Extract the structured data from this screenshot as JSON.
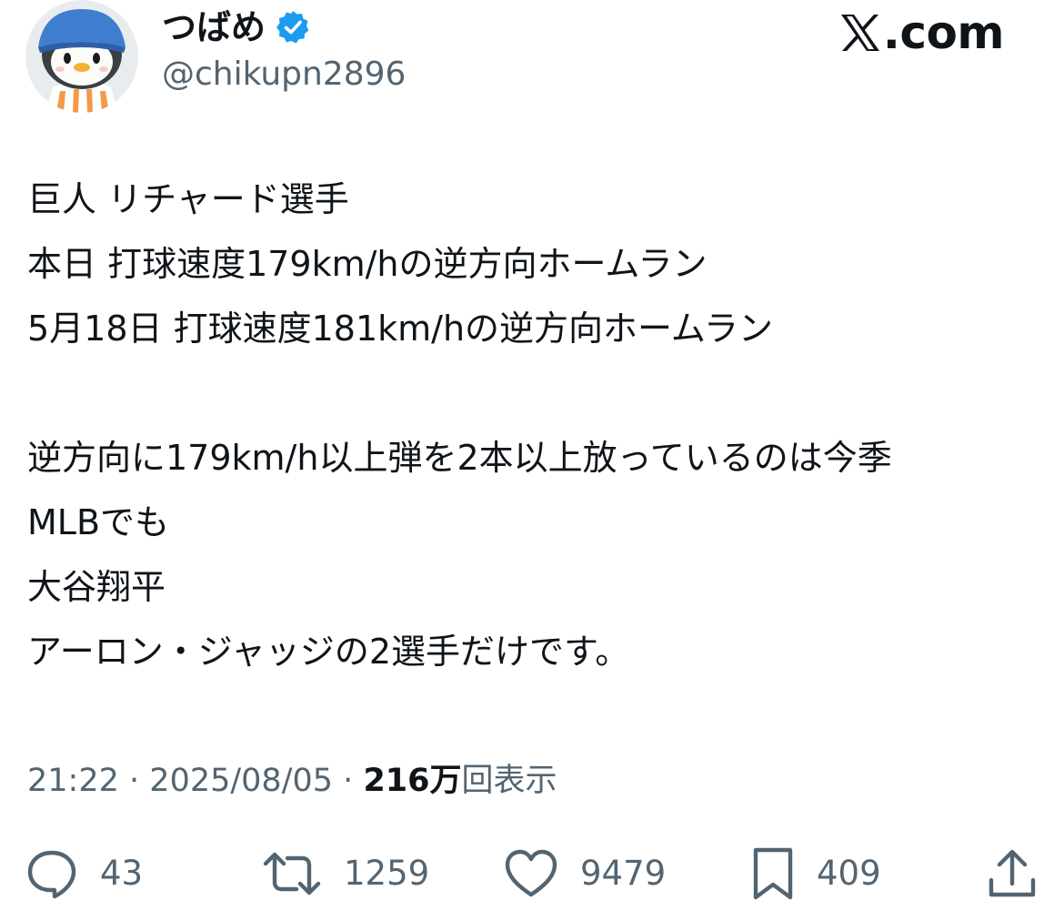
{
  "author": {
    "display_name": "つばめ",
    "handle": "@chikupn2896",
    "verified": true,
    "verified_color": "#1d9bf0"
  },
  "site": {
    "logo_text": ".com",
    "logo_icon": "x-logo-icon"
  },
  "tweet": {
    "lines": [
      "巨人 リチャード選手",
      "本日 打球速度179km/hの逆方向ホームラン",
      "5月18日 打球速度181km/hの逆方向ホームラン",
      "",
      "逆方向に179km/h以上弾を2本以上放っているのは今季",
      "MLBでも",
      "大谷翔平",
      "アーロン・ジャッジの2選手だけです。"
    ]
  },
  "meta": {
    "time": "21:22",
    "separator": "·",
    "date": "2025/08/05",
    "views_count": "216万",
    "views_label": "回表示"
  },
  "actions": {
    "replies": {
      "icon": "reply-icon",
      "count": "43"
    },
    "reposts": {
      "icon": "repost-icon",
      "count": "1259"
    },
    "likes": {
      "icon": "heart-icon",
      "count": "9479"
    },
    "bookmarks": {
      "icon": "bookmark-icon",
      "count": "409"
    },
    "share": {
      "icon": "share-icon"
    }
  },
  "colors": {
    "text_primary": "#0f1419",
    "text_secondary": "#536471",
    "verified_blue": "#1d9bf0",
    "background": "#ffffff"
  }
}
